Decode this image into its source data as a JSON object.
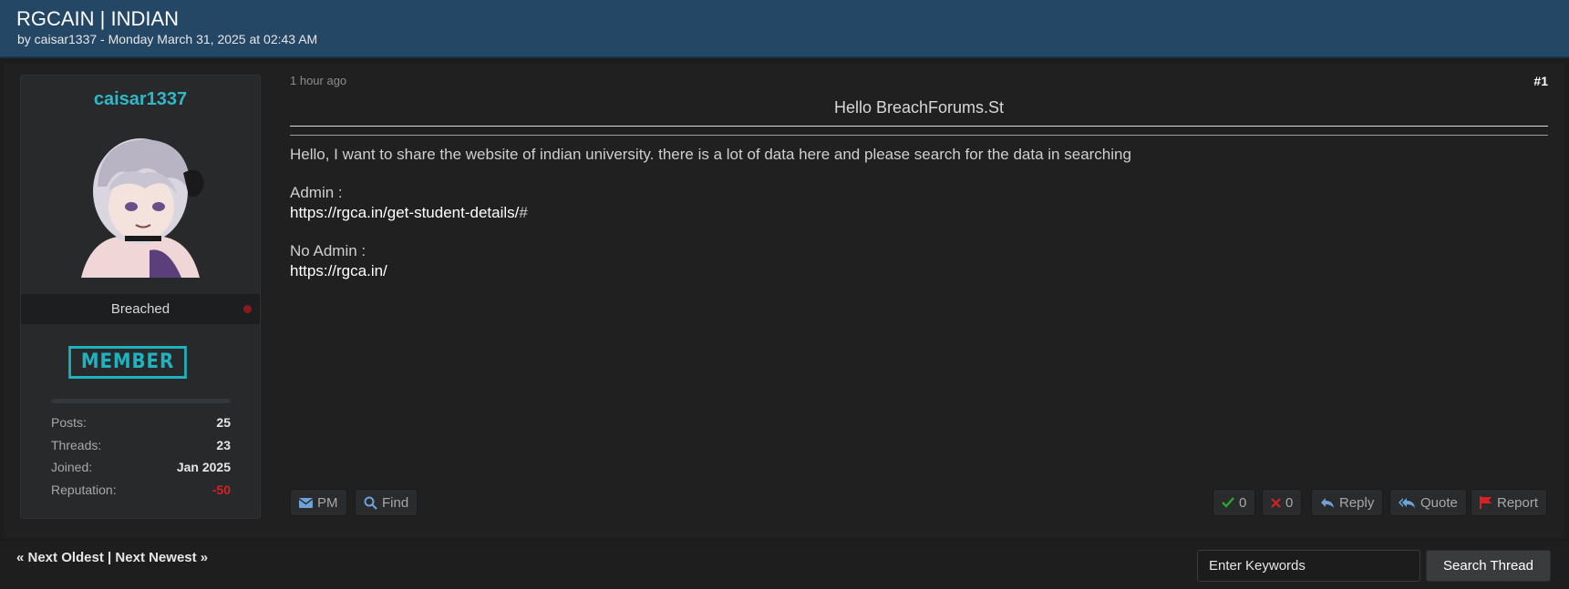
{
  "thread": {
    "title": "RGCAIN | INDIAN",
    "byline": "by caisar1337 - Monday March 31, 2025 at 02:43 AM"
  },
  "user": {
    "name": "caisar1337",
    "usertitle": "Breached",
    "badge": "MEMBER",
    "status": "offline",
    "stats": [
      {
        "label": "Posts:",
        "value": "25"
      },
      {
        "label": "Threads:",
        "value": "23"
      },
      {
        "label": "Joined:",
        "value": "Jan 2025"
      },
      {
        "label": "Reputation:",
        "value": "-50"
      }
    ],
    "progress": 0
  },
  "post": {
    "time": "1 hour ago",
    "number": "#1",
    "heading": "Hello BreachForums.St",
    "body": "Hello, I want to share the website of indian university. there is a lot of data here and please search for the data in searching",
    "admin_label": "Admin :",
    "admin_link": "https://rgca.in/get-student-details/",
    "admin_hash": "#",
    "noadmin_label": "No Admin :",
    "noadmin_link": "https://rgca.in/"
  },
  "actions": {
    "pm": "PM",
    "find": "Find",
    "like_count": "0",
    "dislike_count": "0",
    "reply": "Reply",
    "quote": "Quote",
    "report": "Report"
  },
  "footer": {
    "next_oldest": "« Next Oldest",
    "separator": "|",
    "next_newest": "Next Newest »",
    "search_placeholder": "Enter Keywords",
    "search_button": "Search Thread"
  },
  "colors": {
    "header_bg": "#254766",
    "username": "#2fb8c8",
    "badge": "#1fb3c0",
    "negative_rep": "#d42323",
    "like": "#2ea52e",
    "dislike": "#d42323",
    "report_flag": "#d42323"
  },
  "icons": [
    "avatar-image",
    "envelope-icon",
    "search-icon",
    "check-icon",
    "x-icon",
    "reply-icon",
    "quote-icon",
    "flag-icon"
  ]
}
